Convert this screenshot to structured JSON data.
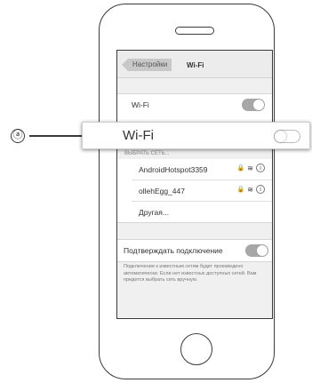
{
  "callout": {
    "marker": "ⓐ",
    "label": "Wi-Fi",
    "toggle_state": "off"
  },
  "screen": {
    "back_label": "Настройки",
    "title": "Wi-Fi",
    "wifi_row_label": "Wi-Fi",
    "wifi_toggle_state": "on",
    "section_header": "ВЫБРАТЬ СЕТЬ...",
    "networks": [
      {
        "name": "AndroidHotspot3359",
        "icons": [
          "lock-icon",
          "wifi-icon",
          "info-icon"
        ]
      },
      {
        "name": "ollehEgg_447",
        "icons": [
          "lock-icon",
          "wifi-icon",
          "info-icon"
        ]
      }
    ],
    "other_label": "Другая...",
    "ask_to_join_label": "Подтверждать подключение",
    "ask_to_join_state": "on",
    "footnote": "Подключение к известным сетям будет произведено автоматически. Если нет известных доступных сетей. Вам придется выбрать сеть вручную."
  },
  "glyphs": {
    "lock": "🔒",
    "wifi": "≋",
    "info": "i"
  },
  "colors": {
    "toggle_on": "#a7a7a7",
    "outline": "#3a3a3a"
  }
}
